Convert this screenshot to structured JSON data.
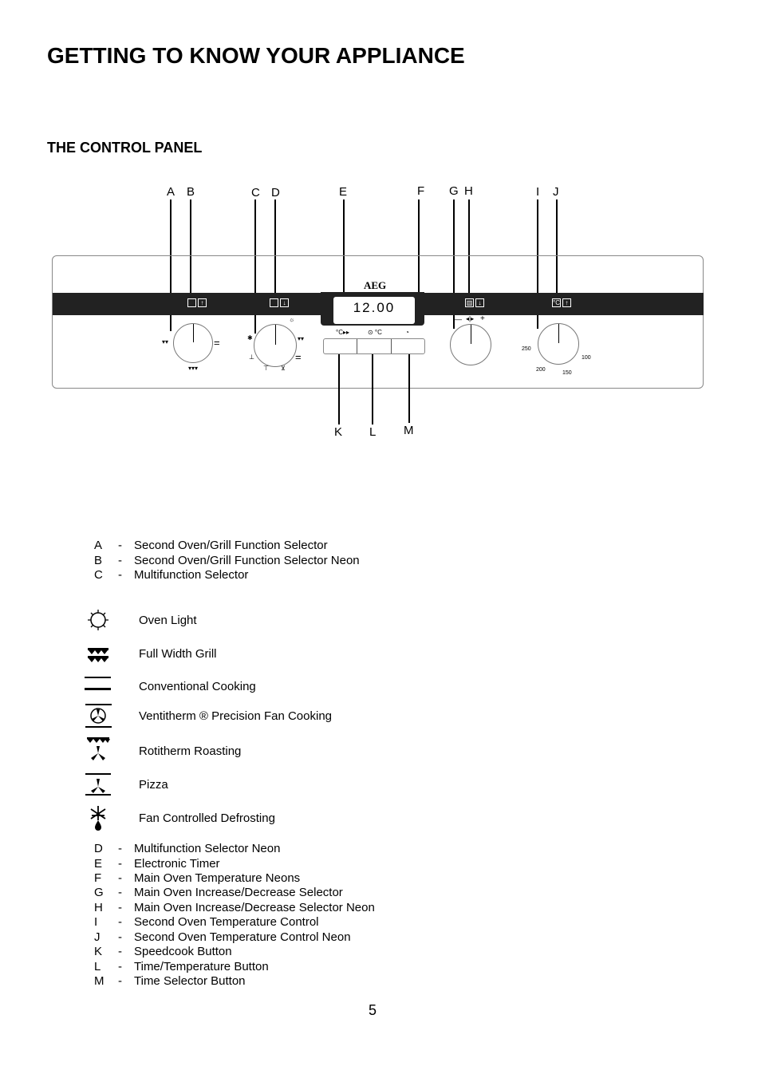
{
  "page": {
    "title": "GETTING TO KNOW YOUR APPLIANCE",
    "section_title": "THE CONTROL PANEL",
    "page_number": "5"
  },
  "diagram": {
    "brand": "AEG",
    "display_time": "12.00",
    "callouts_top": [
      "A",
      "B",
      "C",
      "D",
      "E",
      "F",
      "G",
      "H",
      "I",
      "J"
    ],
    "callouts_bottom": [
      "K",
      "L",
      "M"
    ],
    "button_symbols": [
      "°C▸▸",
      "⊙ °C",
      "◔"
    ],
    "temperature_scale": [
      "250",
      "200",
      "150",
      "100"
    ],
    "increase_decrease_symbols": [
      "—",
      "◂|▸",
      "+"
    ]
  },
  "legend_part1": [
    {
      "key": "A",
      "dash": "-",
      "text": "Second Oven/Grill Function Selector"
    },
    {
      "key": "B",
      "dash": "-",
      "text": "Second Oven/Grill Function Selector Neon"
    },
    {
      "key": "C",
      "dash": "-",
      "text": "Multifunction Selector"
    }
  ],
  "functions": [
    {
      "icon": "oven-light-icon",
      "text": "Oven Light"
    },
    {
      "icon": "full-width-grill-icon",
      "text": "Full Width Grill"
    },
    {
      "icon": "conventional-cooking-icon",
      "text": "Conventional Cooking"
    },
    {
      "icon": "fan-cooking-icon",
      "text": "Ventitherm ® Precision Fan Cooking"
    },
    {
      "icon": "rotitherm-roasting-icon",
      "text": "Rotitherm Roasting"
    },
    {
      "icon": "pizza-icon",
      "text": "Pizza"
    },
    {
      "icon": "fan-defrost-icon",
      "text": "Fan Controlled Defrosting"
    }
  ],
  "legend_part2": [
    {
      "key": "D",
      "dash": "-",
      "text": "Multifunction Selector Neon"
    },
    {
      "key": "E",
      "dash": "-",
      "text": "Electronic Timer"
    },
    {
      "key": "F",
      "dash": "-",
      "text": "Main Oven Temperature Neons"
    },
    {
      "key": "G",
      "dash": "-",
      "text": "Main Oven Increase/Decrease Selector"
    },
    {
      "key": "H",
      "dash": "-",
      "text": "Main Oven Increase/Decrease Selector Neon"
    },
    {
      "key": "I",
      "dash": "-",
      "text": "Second Oven Temperature Control"
    },
    {
      "key": "J",
      "dash": "-",
      "text": "Second Oven Temperature Control Neon"
    },
    {
      "key": "K",
      "dash": "-",
      "text": "Speedcook Button"
    },
    {
      "key": "L",
      "dash": "-",
      "text": "Time/Temperature Button"
    },
    {
      "key": "M",
      "dash": "-",
      "text": "Time Selector Button"
    }
  ]
}
